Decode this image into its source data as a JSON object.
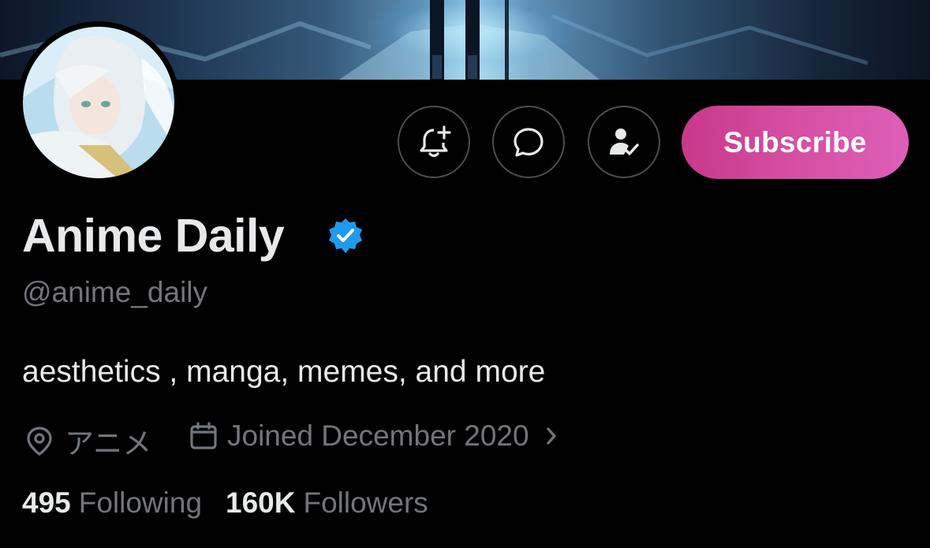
{
  "profile": {
    "display_name": "Anime Daily",
    "handle": "@anime_daily",
    "bio": "aesthetics , manga, memes, and more",
    "location": "アニメ",
    "joined": "Joined December 2020",
    "verified": true
  },
  "actions": {
    "notify_icon": "bell-plus-icon",
    "message_icon": "message-bubble-icon",
    "subscriber_icon": "person-check-icon",
    "subscribe_label": "Subscribe"
  },
  "stats": {
    "following_count": "495",
    "following_label": "Following",
    "followers_count": "160K",
    "followers_label": "Followers"
  },
  "colors": {
    "background": "#000000",
    "verified_blue": "#1d9bf0",
    "subscribe_gradient_start": "#c8378a",
    "subscribe_gradient_end": "#dd5fb8",
    "muted_text": "#71767b"
  }
}
